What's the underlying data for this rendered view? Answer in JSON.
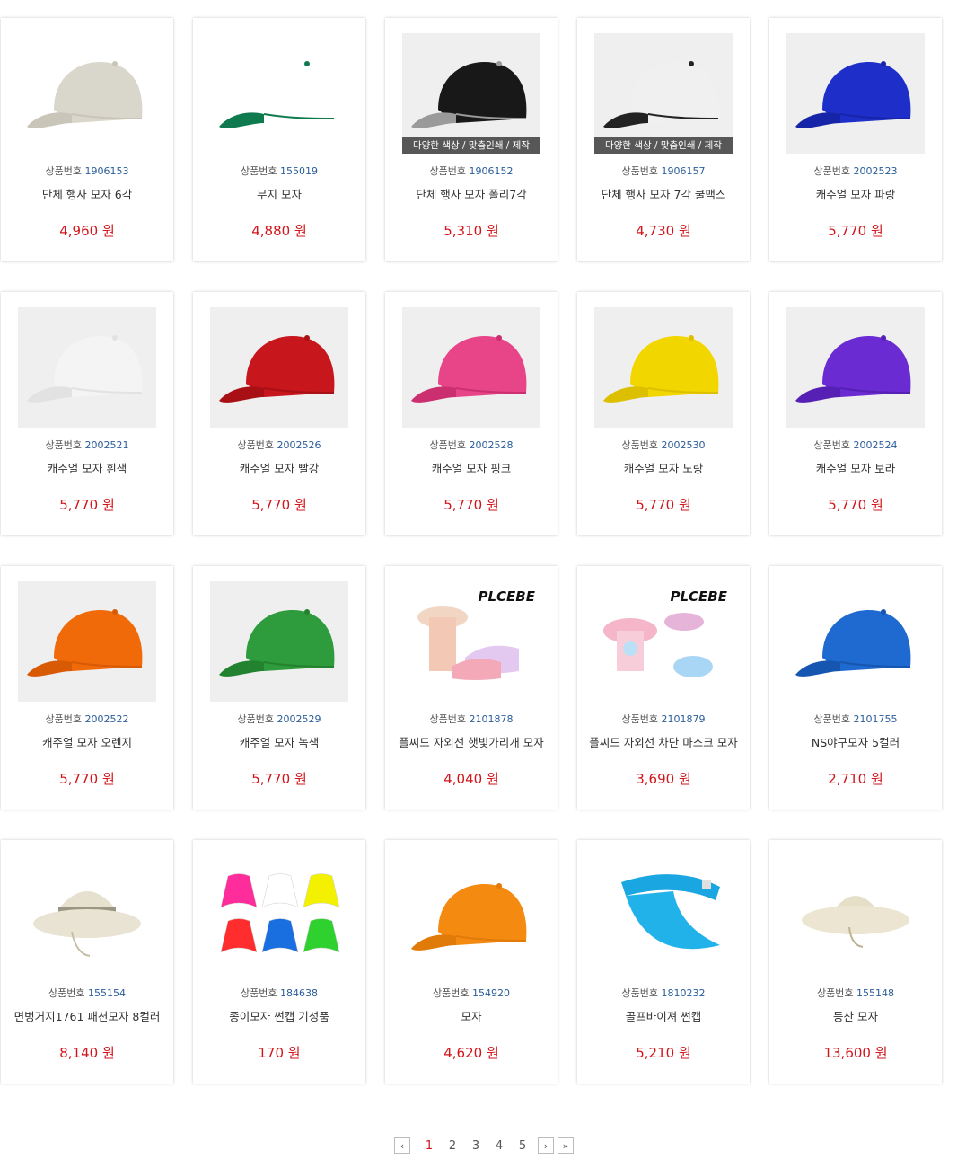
{
  "code_label": "상품번호",
  "currency": "원",
  "ribbon_text": "다양한 색상 / 맞춤인쇄 / 제작",
  "products": [
    {
      "code": "1906153",
      "name": "단체 행사 모자 6각",
      "price": "4,960",
      "image": "beige-cap"
    },
    {
      "code": "155019",
      "name": "무지 모자",
      "price": "4,880",
      "image": "white-green-cap"
    },
    {
      "code": "1906152",
      "name": "단체 행사 모자 폴리7각",
      "price": "5,310",
      "image": "black-cap-ribbon"
    },
    {
      "code": "1906157",
      "name": "단체 행사 모자 7각 쿨맥스",
      "price": "4,730",
      "image": "white-cap-ribbon"
    },
    {
      "code": "2002523",
      "name": "캐주얼 모자 파랑",
      "price": "5,770",
      "image": "blue-cap"
    },
    {
      "code": "2002521",
      "name": "캐주얼 모자 흰색",
      "price": "5,770",
      "image": "white-cap"
    },
    {
      "code": "2002526",
      "name": "캐주얼 모자 빨강",
      "price": "5,770",
      "image": "red-cap"
    },
    {
      "code": "2002528",
      "name": "캐주얼 모자 핑크",
      "price": "5,770",
      "image": "pink-cap"
    },
    {
      "code": "2002530",
      "name": "캐주얼 모자 노랑",
      "price": "5,770",
      "image": "yellow-cap"
    },
    {
      "code": "2002524",
      "name": "캐주얼 모자 보라",
      "price": "5,770",
      "image": "purple-cap"
    },
    {
      "code": "2002522",
      "name": "캐주얼 모자 오렌지",
      "price": "5,770",
      "image": "orange-cap"
    },
    {
      "code": "2002529",
      "name": "캐주얼 모자 녹색",
      "price": "5,770",
      "image": "green-cap"
    },
    {
      "code": "2101878",
      "name": "플씨드 자외선 햇빛가리개 모자",
      "price": "4,040",
      "image": "sun-visor-set",
      "brand": "PLCEBE"
    },
    {
      "code": "2101879",
      "name": "플씨드 자외선 차단 마스크 모자",
      "price": "3,690",
      "image": "mask-hat-set",
      "brand": "PLCEBE"
    },
    {
      "code": "2101755",
      "name": "NS야구모자 5컬러",
      "price": "2,710",
      "image": "royal-blue-cap"
    },
    {
      "code": "155154",
      "name": "면벙거지1761 패션모자 8컬러",
      "price": "8,140",
      "image": "bucket-hat"
    },
    {
      "code": "184638",
      "name": "종이모자 썬캡 기성품",
      "price": "170",
      "image": "paper-visors"
    },
    {
      "code": "154920",
      "name": "모자",
      "price": "4,620",
      "image": "orange-cap-piping"
    },
    {
      "code": "1810232",
      "name": "골프바이져 썬캡",
      "price": "5,210",
      "image": "sky-visor"
    },
    {
      "code": "155148",
      "name": "등산 모자",
      "price": "13,600",
      "image": "hiking-hat"
    }
  ],
  "pagination": {
    "prev": "‹",
    "pages": [
      "1",
      "2",
      "3",
      "4",
      "5"
    ],
    "current": "1",
    "next": "›",
    "last": "»"
  },
  "colors": {
    "price": "#d1161b",
    "code_number": "#2a5d9a"
  }
}
